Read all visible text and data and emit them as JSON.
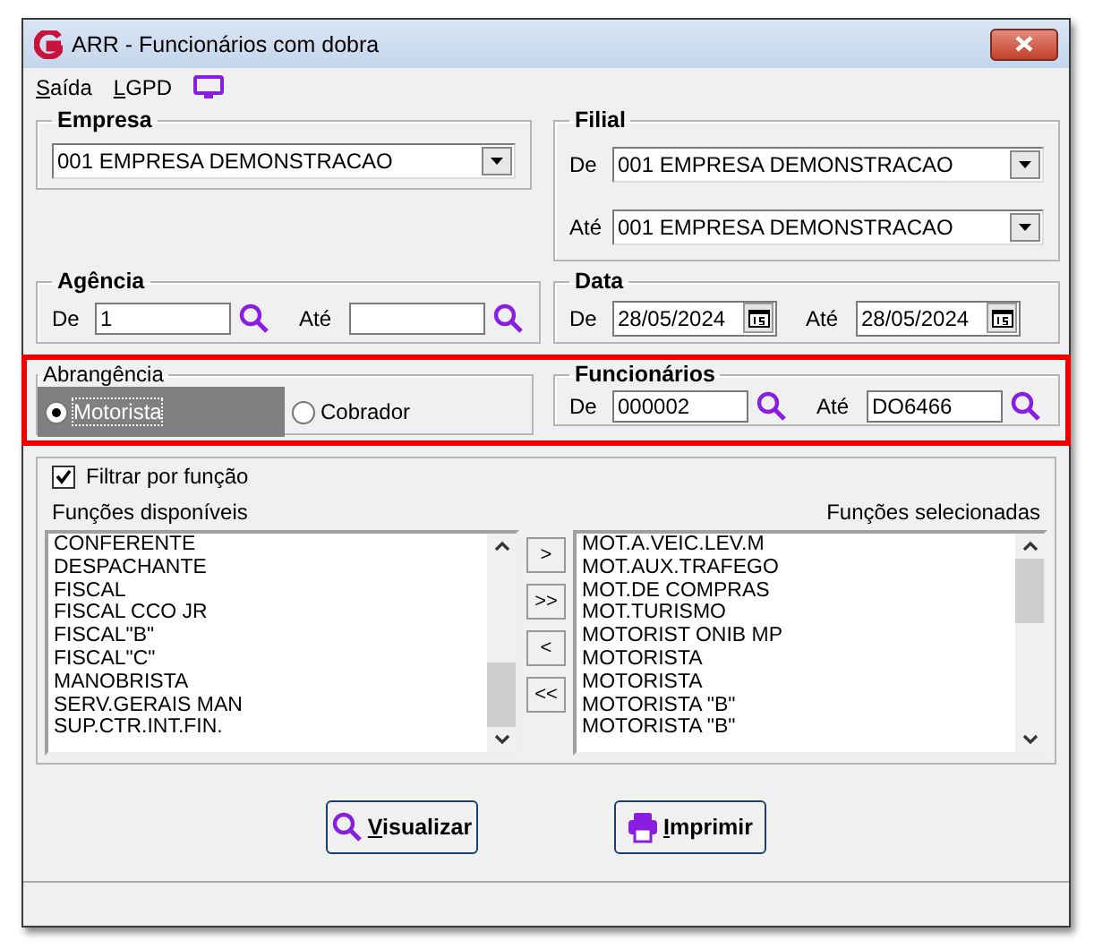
{
  "window": {
    "title": "ARR - Funcionários com dobra"
  },
  "menu": [
    {
      "label": "Saída"
    },
    {
      "label": "LGPD"
    }
  ],
  "empresa": {
    "title": "Empresa",
    "value": "001 EMPRESA DEMONSTRACAO"
  },
  "filial": {
    "title": "Filial",
    "from_label": "De",
    "from": "001 EMPRESA DEMONSTRACAO",
    "to_label": "Até",
    "to": "001 EMPRESA DEMONSTRACAO"
  },
  "agencia": {
    "title": "Agência",
    "from_label": "De",
    "from": "1",
    "to_label": "Até"
  },
  "data": {
    "title": "Data",
    "from_label": "De",
    "from": "28/05/2024",
    "to_label": "Até",
    "to": "28/05/2024"
  },
  "abrangencia": {
    "title": "Abrangência",
    "options": [
      {
        "label": "Motorista",
        "selected": true
      },
      {
        "label": "Cobrador",
        "selected": false
      }
    ]
  },
  "funcionarios": {
    "title": "Funcionários",
    "from_label": "De",
    "from": "000002",
    "to_label": "Até",
    "to": "DO6466"
  },
  "filter": {
    "label": "Filtrar por função",
    "checked": true
  },
  "available": {
    "title": "Funções disponíveis",
    "items": [
      "CONFERENTE",
      "DESPACHANTE",
      "FISCAL",
      "FISCAL CCO JR",
      "FISCAL\"B\"",
      "FISCAL\"C\"",
      "MANOBRISTA",
      "SERV.GERAIS MAN",
      "SUP.CTR.INT.FIN."
    ]
  },
  "transfer_buttons": [
    ">",
    ">>",
    "<",
    "<<"
  ],
  "chosen": {
    "title": "Funções selecionadas",
    "items": [
      "MOT.A.VEIC.LEV.M",
      "MOT.AUX.TRAFEGO",
      "MOT.DE COMPRAS",
      "MOT.TURISMO",
      "MOTORIST ONIB MP",
      "MOTORISTA",
      "MOTORISTA",
      "MOTORISTA \"B\"",
      "MOTORISTA \"B\""
    ]
  },
  "buttons": [
    {
      "label": "Visualizar",
      "kind": "view"
    },
    {
      "label": "Imprimir",
      "kind": "print"
    }
  ]
}
